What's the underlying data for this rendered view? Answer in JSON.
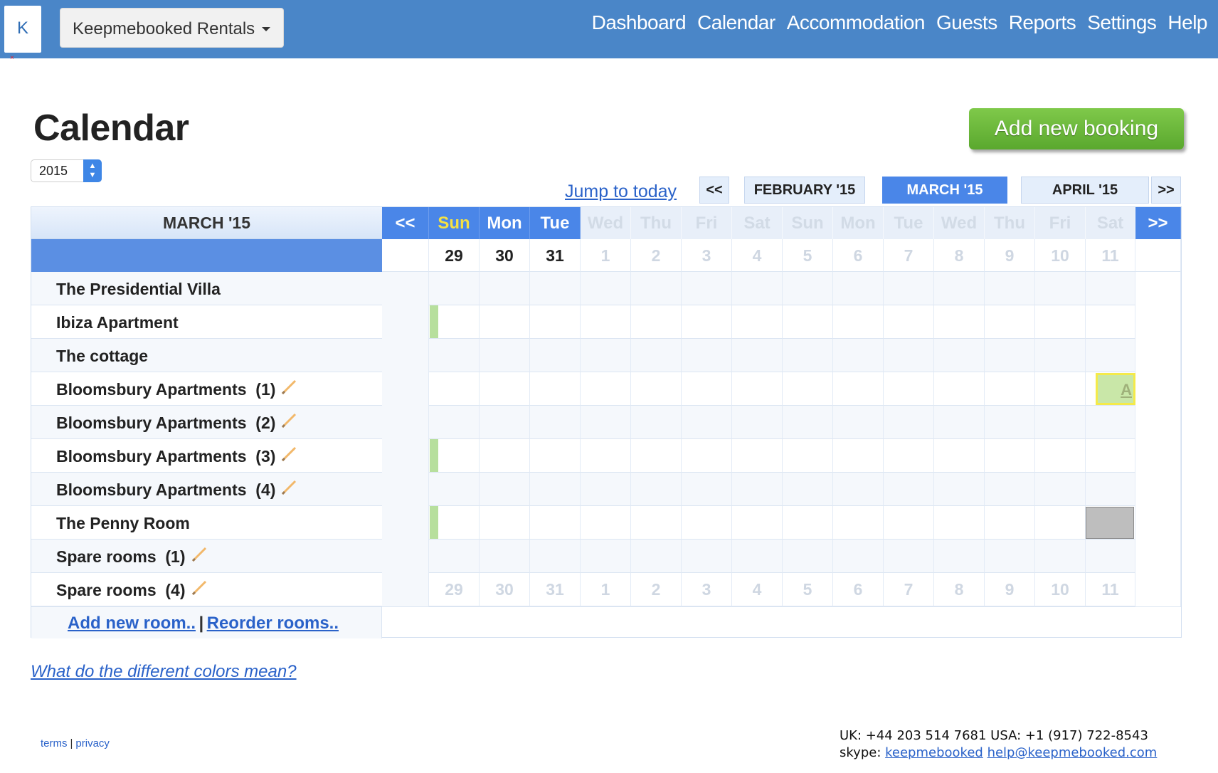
{
  "app": {
    "logo_letter": "K",
    "logo_mark": "×",
    "account_name": "Keepmebooked Rentals",
    "nav": [
      "Dashboard",
      "Calendar",
      "Accommodation",
      "Guests",
      "Reports",
      "Settings",
      "Help"
    ]
  },
  "page": {
    "title": "Calendar",
    "year": "2015",
    "add_booking_label": "Add new booking",
    "jump_today_label": "Jump to today"
  },
  "month_nav": {
    "prev": "<<",
    "next": ">>",
    "months": [
      {
        "label": "FEBRUARY '15",
        "active": false
      },
      {
        "label": "MARCH '15",
        "active": true
      },
      {
        "label": "APRIL '15",
        "active": false
      }
    ]
  },
  "calendar": {
    "month_label": "MARCH '15",
    "prev": "<<",
    "next": ">>",
    "days": [
      {
        "dow": "Sun",
        "date": "29",
        "faded": false,
        "today": true
      },
      {
        "dow": "Mon",
        "date": "30",
        "faded": false,
        "today": false
      },
      {
        "dow": "Tue",
        "date": "31",
        "faded": false,
        "today": false
      },
      {
        "dow": "Wed",
        "date": "1",
        "faded": true
      },
      {
        "dow": "Thu",
        "date": "2",
        "faded": true
      },
      {
        "dow": "Fri",
        "date": "3",
        "faded": true
      },
      {
        "dow": "Sat",
        "date": "4",
        "faded": true
      },
      {
        "dow": "Sun",
        "date": "5",
        "faded": true
      },
      {
        "dow": "Mon",
        "date": "6",
        "faded": true
      },
      {
        "dow": "Tue",
        "date": "7",
        "faded": true
      },
      {
        "dow": "Wed",
        "date": "8",
        "faded": true
      },
      {
        "dow": "Thu",
        "date": "9",
        "faded": true
      },
      {
        "dow": "Fri",
        "date": "10",
        "faded": true
      },
      {
        "dow": "Sat",
        "date": "11",
        "faded": true
      }
    ],
    "rooms": [
      {
        "name": "The Presidential Villa",
        "unit": "",
        "editable": false,
        "arrival_marker": false
      },
      {
        "name": "Ibiza Apartment",
        "unit": "",
        "editable": false,
        "arrival_marker": true
      },
      {
        "name": "The cottage",
        "unit": "",
        "editable": false,
        "arrival_marker": false
      },
      {
        "name": "Bloomsbury Apartments",
        "unit": "(1)",
        "editable": true,
        "arrival_marker": false
      },
      {
        "name": "Bloomsbury Apartments",
        "unit": "(2)",
        "editable": true,
        "arrival_marker": false
      },
      {
        "name": "Bloomsbury Apartments",
        "unit": "(3)",
        "editable": true,
        "arrival_marker": true
      },
      {
        "name": "Bloomsbury Apartments",
        "unit": "(4)",
        "editable": true,
        "arrival_marker": false
      },
      {
        "name": "The Penny Room",
        "unit": "",
        "editable": false,
        "arrival_marker": true
      },
      {
        "name": "Spare rooms",
        "unit": "(1)",
        "editable": true,
        "arrival_marker": false
      },
      {
        "name": "Spare rooms",
        "unit": "(4)",
        "editable": true,
        "arrival_marker": false
      }
    ],
    "bookings": [
      {
        "room_index": 3,
        "day_index": 13,
        "label": "A",
        "status": "provisional"
      },
      {
        "room_index": 7,
        "day_index": 13,
        "label": "",
        "status": "blocked"
      }
    ],
    "add_room_label": "Add new room..",
    "separator": "|",
    "reorder_label": "Reorder rooms.."
  },
  "colors_link": "What do the different colors mean?",
  "footer": {
    "terms": "terms",
    "separator": "|",
    "privacy": "privacy",
    "phones": "UK: +44 203 514 7681 USA: +1 (917) 722-8543",
    "skype_label": "skype:",
    "skype": "keepmebooked",
    "email": "help@keepmebooked.com"
  },
  "colors": {
    "topbar": "#4a86c8",
    "accent": "#4a86e8",
    "add_button": "#5aa82e",
    "arrival_marker": "#b7df9d",
    "booking_provisional": "#c9e7a8",
    "booking_blocked": "#bebebe",
    "today_text": "#f5e142"
  }
}
